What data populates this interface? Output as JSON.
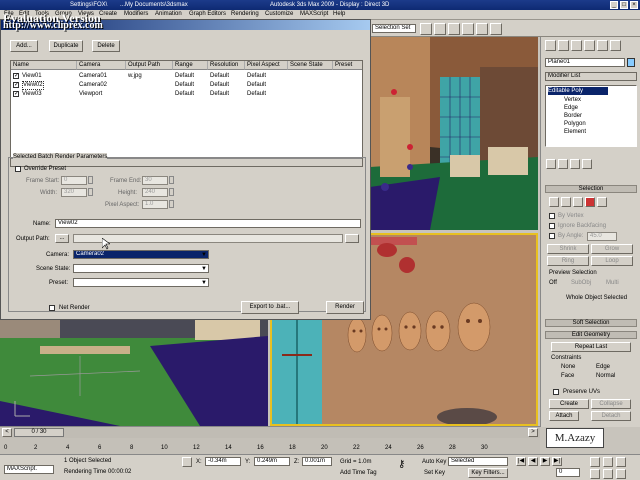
{
  "app": {
    "title": "Autodesk 3ds Max 2009     - Display : Direct 3D",
    "title_left": "...My Documents\\3dsmax",
    "title_left_prefix": "Settings\\FOX\\"
  },
  "watermark": {
    "line1": "Evaluation Version",
    "line2": "http://www.cliprex.com"
  },
  "menu": [
    "File",
    "Edit",
    "Tools",
    "Group",
    "Views",
    "Create",
    "Modifiers",
    "Animation",
    "Graph Editors",
    "Rendering",
    "Customize",
    "MAXScript",
    "Help"
  ],
  "toolbar": {
    "selection_filter": "All",
    "select_region": "Selection Set"
  },
  "dialog": {
    "add": "Add...",
    "duplicate": "Duplicate",
    "delete": "Delete",
    "columns": [
      "Name",
      "Camera",
      "Output Path",
      "Range",
      "Resolution",
      "Pixel Aspect",
      "Scene State",
      "Preset"
    ],
    "rows": [
      {
        "checked": true,
        "name": "View01",
        "camera": "Camera01",
        "output": "w.jpg",
        "range": "Default",
        "resolution": "Default",
        "aspect": "Default",
        "state": "",
        "preset": ""
      },
      {
        "checked": true,
        "name": "View02",
        "camera": "Camera02",
        "output": "",
        "range": "Default",
        "resolution": "Default",
        "aspect": "Default",
        "state": "",
        "preset": ""
      },
      {
        "checked": true,
        "name": "View03",
        "camera": "Viewport",
        "output": "",
        "range": "Default",
        "resolution": "Default",
        "aspect": "Default",
        "state": "",
        "preset": ""
      }
    ],
    "group_title": "Selected Batch Render Parameters",
    "override_preset": "Override Preset",
    "frame_start_label": "Frame Start:",
    "frame_start": "0",
    "frame_end_label": "Frame End:",
    "frame_end": "30",
    "width_label": "Width:",
    "width": "320",
    "height_label": "Height:",
    "height": "240",
    "pixel_aspect_label": "Pixel Aspect:",
    "pixel_aspect": "1.0",
    "name_label": "Name:",
    "name_value": "View02",
    "output_path_label": "Output Path:",
    "output_path_btn": "...",
    "camera_label": "Camera:",
    "camera_value": "Camera02",
    "scene_state_label": "Scene State:",
    "scene_state_value": "",
    "preset_label": "Preset:",
    "preset_value": "",
    "net_render": "Net Render",
    "export": "Export to .bat...",
    "render": "Render"
  },
  "command_panel": {
    "object_name": "Plane01",
    "modifier_list": "Modifier List",
    "stack_root": "Editable Poly",
    "stack_items": [
      "Vertex",
      "Edge",
      "Border",
      "Polygon",
      "Element"
    ],
    "selection": "Selection",
    "by_vertex": "By Vertex",
    "ignore_backfacing": "Ignore Backfacing",
    "by_angle": "By Angle:",
    "by_angle_value": "45.0",
    "shrink": "Shrink",
    "grow": "Grow",
    "ring": "Ring",
    "loop": "Loop",
    "preview_selection": "Preview Selection",
    "off": "Off",
    "subobj": "SubObj",
    "multi": "Multi",
    "whole_object": "Whole Object Selected",
    "soft_selection": "Soft Selection",
    "edit_geometry": "Edit Geometry",
    "repeat_last": "Repeat Last",
    "constraints": "Constraints",
    "none": "None",
    "edge": "Edge",
    "face": "Face",
    "normal": "Normal",
    "preserve_uvs": "Preserve UVs",
    "create": "Create",
    "collapse": "Collapse",
    "attach": "Attach",
    "detach": "Detach"
  },
  "timeline": {
    "frame": "0 / 30",
    "ticks": [
      "0",
      "2",
      "4",
      "6",
      "8",
      "10",
      "12",
      "14",
      "16",
      "18",
      "20",
      "22",
      "24",
      "26",
      "28",
      "30"
    ]
  },
  "status": {
    "maxscript": "MAXScript.",
    "selected": "1 Object Selected",
    "rendering_time": "Rendering Time  00:00:02",
    "x": "-0.34m",
    "y": "0.249m",
    "z": "0.001m",
    "grid": "Grid = 1.0m",
    "add_time_tag": "Add Time Tag",
    "auto_key": "Auto Key",
    "set_key": "Set Key",
    "key_mode": "Selected",
    "key_filters": "Key Filters...",
    "frame_field": "0"
  },
  "credit": "M.Azazy"
}
